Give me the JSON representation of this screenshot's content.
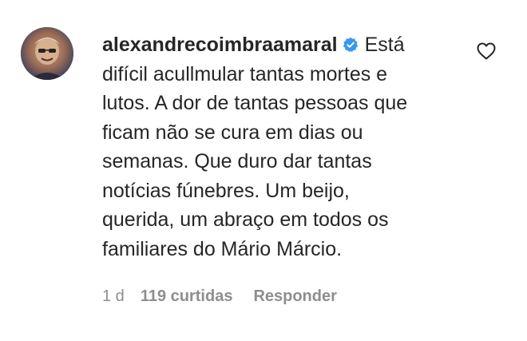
{
  "comment": {
    "username": "alexandrecoimbraamaral",
    "text_lines": [
      "Está",
      "difícil acullmular tantas mortes e",
      "lutos. A dor de tantas pessoas que",
      "ficam não se cura em dias ou",
      "semanas. Que duro dar tantas",
      "notícias fúnebres. Um beijo,",
      "querida, um abraço em todos os",
      "familiares do Mário Márcio."
    ],
    "time": "1 d",
    "likes": "119 curtidas",
    "reply_label": "Responder"
  },
  "colors": {
    "text": "#262626",
    "meta": "#8e8e8e",
    "verified_badge": "#3897f0"
  },
  "icons": {
    "verified": "verified-badge-icon",
    "like": "heart-outline-icon"
  }
}
